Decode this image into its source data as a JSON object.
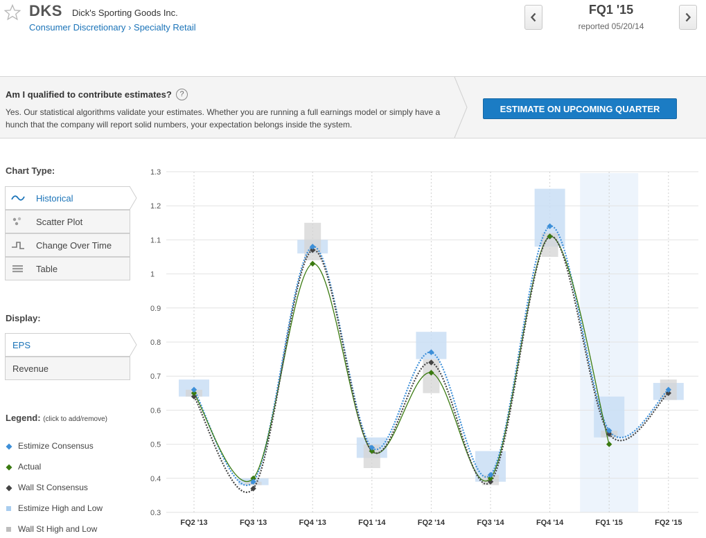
{
  "header": {
    "ticker": "DKS",
    "company": "Dick's Sporting Goods Inc.",
    "sector": "Consumer Discretionary",
    "industry": "Specialty Retail",
    "breadcrumb_sep": "›",
    "quarter": "FQ1 '15",
    "reported": "reported 05/20/14"
  },
  "banner": {
    "question": "Am I qualified to contribute estimates?",
    "help": "?",
    "body": "Yes. Our statistical algorithms validate your estimates. Whether you are running a full earnings model or simply have a hunch that the company will report solid numbers, your expectation belongs inside the system.",
    "button": "ESTIMATE ON UPCOMING QUARTER"
  },
  "sidebar": {
    "chart_type_title": "Chart Type:",
    "chart_types": [
      "Historical",
      "Scatter Plot",
      "Change Over Time",
      "Table"
    ],
    "chart_type_selected": 0,
    "display_title": "Display:",
    "display_options": [
      "EPS",
      "Revenue"
    ],
    "display_selected": 0,
    "legend_title": "Legend:",
    "legend_hint": "(click to add/remove)",
    "legend": [
      "Estimize Consensus",
      "Actual",
      "Wall St Consensus",
      "Estimize High and Low",
      "Wall St High and Low"
    ]
  },
  "colors": {
    "link": "#1a73b8",
    "estimize": "#3d8fd8",
    "actual": "#3a7a10",
    "wallst": "#444444",
    "estimize_band": "#c9def4",
    "wallst_band": "#d4d4d4",
    "highlight": "#edf4fc",
    "button": "#1b7cc4"
  },
  "chart_data": {
    "type": "line",
    "categories": [
      "FQ2 '13",
      "FQ3 '13",
      "FQ4 '13",
      "FQ1 '14",
      "FQ2 '14",
      "FQ3 '14",
      "FQ4 '14",
      "FQ1 '15",
      "FQ2 '15"
    ],
    "ylim": [
      0.3,
      1.3
    ],
    "yticks": [
      0.3,
      0.4,
      0.5,
      0.6,
      0.7,
      0.8,
      0.9,
      1,
      1.1,
      1.2,
      1.3
    ],
    "grid": true,
    "highlight_category": "FQ1 '15",
    "series": [
      {
        "name": "Estimize Consensus",
        "values": [
          0.66,
          0.39,
          1.08,
          0.49,
          0.77,
          0.41,
          1.14,
          0.54,
          0.66
        ]
      },
      {
        "name": "Actual",
        "values": [
          0.65,
          0.4,
          1.03,
          0.48,
          0.71,
          0.4,
          1.11,
          0.5,
          null
        ]
      },
      {
        "name": "Wall St Consensus",
        "values": [
          0.64,
          0.37,
          1.07,
          0.48,
          0.74,
          0.39,
          1.11,
          0.53,
          0.65
        ]
      }
    ],
    "ranges": [
      {
        "name": "Estimize High and Low",
        "low": [
          0.64,
          0.38,
          1.06,
          0.46,
          0.75,
          0.39,
          1.08,
          0.52,
          0.63
        ],
        "high": [
          0.69,
          0.4,
          1.1,
          0.52,
          0.83,
          0.48,
          1.25,
          0.64,
          0.68
        ]
      },
      {
        "name": "Wall St High and Low",
        "low": [
          0.64,
          0.38,
          1.04,
          0.43,
          0.65,
          0.38,
          1.05,
          0.52,
          0.63
        ],
        "high": [
          0.66,
          0.39,
          1.15,
          0.5,
          0.75,
          0.41,
          1.12,
          0.54,
          0.69
        ]
      }
    ]
  }
}
